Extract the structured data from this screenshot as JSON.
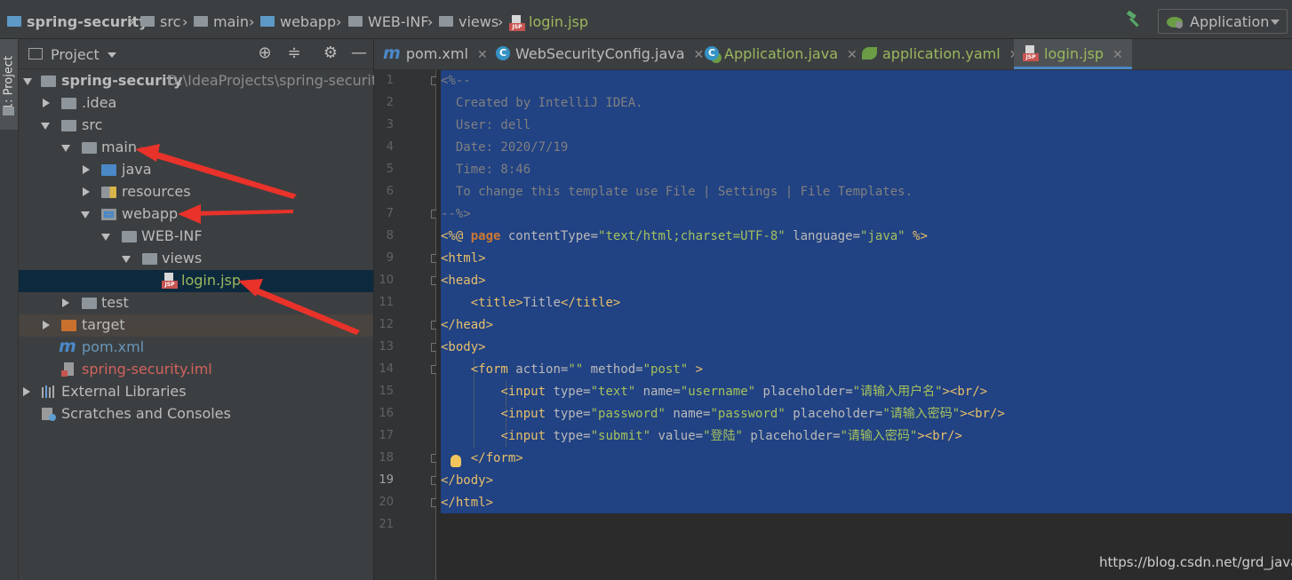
{
  "breadcrumbs": [
    {
      "label": "spring-security",
      "icon": "module-folder-icon",
      "bold": true
    },
    {
      "label": "src",
      "icon": "folder-icon"
    },
    {
      "label": "main",
      "icon": "folder-icon"
    },
    {
      "label": "webapp",
      "icon": "web-folder-icon"
    },
    {
      "label": "WEB-INF",
      "icon": "folder-icon"
    },
    {
      "label": "views",
      "icon": "folder-icon"
    },
    {
      "label": "login.jsp",
      "icon": "jsp-file-icon",
      "active": true
    }
  ],
  "run_config": {
    "label": "Application"
  },
  "tool_strip": {
    "project_tab": "1: Project"
  },
  "project_panel": {
    "title": "Project",
    "tree": [
      {
        "label": "spring-security",
        "path": "D:\\IdeaProjects\\spring-security",
        "icon": "module-folder-icon",
        "expanded": true
      },
      {
        "label": ".idea",
        "icon": "folder-icon",
        "expanded": false
      },
      {
        "label": "src",
        "icon": "folder-icon",
        "expanded": true
      },
      {
        "label": "main",
        "icon": "folder-icon",
        "expanded": true
      },
      {
        "label": "java",
        "icon": "source-folder-icon",
        "expanded": false
      },
      {
        "label": "resources",
        "icon": "resources-folder-icon",
        "expanded": false
      },
      {
        "label": "webapp",
        "icon": "web-folder-icon",
        "expanded": true
      },
      {
        "label": "WEB-INF",
        "icon": "folder-icon",
        "expanded": true
      },
      {
        "label": "views",
        "icon": "folder-icon",
        "expanded": true
      },
      {
        "label": "login.jsp",
        "icon": "jsp-file-icon",
        "selected": true
      },
      {
        "label": "test",
        "icon": "folder-icon",
        "expanded": false
      },
      {
        "label": "target",
        "icon": "excluded-folder-icon",
        "expanded": false
      },
      {
        "label": "pom.xml",
        "icon": "maven-icon"
      },
      {
        "label": "spring-security.iml",
        "icon": "iml-file-icon"
      },
      {
        "label": "External Libraries",
        "icon": "libraries-icon",
        "expanded": false
      },
      {
        "label": "Scratches and Consoles",
        "icon": "scratches-icon"
      }
    ]
  },
  "tabs": [
    {
      "label": "pom.xml",
      "icon": "maven-icon"
    },
    {
      "label": "WebSecurityConfig.java",
      "icon": "class-icon"
    },
    {
      "label": "Application.java",
      "icon": "spring-class-icon"
    },
    {
      "label": "application.yaml",
      "icon": "spring-yaml-icon"
    },
    {
      "label": "login.jsp",
      "icon": "jsp-file-icon",
      "active": true
    }
  ],
  "editor": {
    "line_numbers": [
      "1",
      "2",
      "3",
      "4",
      "5",
      "6",
      "7",
      "8",
      "9",
      "10",
      "11",
      "12",
      "13",
      "14",
      "15",
      "16",
      "17",
      "18",
      "19",
      "20",
      "21"
    ],
    "current_line": "19",
    "lines": [
      [
        {
          "t": "<%--",
          "c": "comment"
        }
      ],
      [
        {
          "t": "  Created by IntelliJ IDEA.",
          "c": "comment"
        }
      ],
      [
        {
          "t": "  User: dell",
          "c": "comment"
        }
      ],
      [
        {
          "t": "  Date: 2020/7/19",
          "c": "comment"
        }
      ],
      [
        {
          "t": "  Time: 8:46",
          "c": "comment"
        }
      ],
      [
        {
          "t": "  To change this template use File | Settings | File Templates.",
          "c": "comment"
        }
      ],
      [
        {
          "t": "--%>",
          "c": "comment"
        }
      ],
      [
        {
          "t": "<%@ ",
          "c": "tag"
        },
        {
          "t": "page",
          "c": "kw"
        },
        {
          "t": " contentType=",
          "c": "attr"
        },
        {
          "t": "\"text/html;charset=UTF-8\"",
          "c": "str"
        },
        {
          "t": " language=",
          "c": "attr"
        },
        {
          "t": "\"java\"",
          "c": "str"
        },
        {
          "t": " %>",
          "c": "tag"
        }
      ],
      [
        {
          "t": "<html>",
          "c": "tag"
        }
      ],
      [
        {
          "t": "<head>",
          "c": "tag"
        }
      ],
      [
        {
          "t": "    ",
          "c": "plain"
        },
        {
          "t": "<title>",
          "c": "tag"
        },
        {
          "t": "Title",
          "c": "plain"
        },
        {
          "t": "</title>",
          "c": "tag"
        }
      ],
      [
        {
          "t": "</head>",
          "c": "tag"
        }
      ],
      [
        {
          "t": "<body>",
          "c": "tag"
        }
      ],
      [
        {
          "t": "    ",
          "c": "plain"
        },
        {
          "t": "<form ",
          "c": "tag"
        },
        {
          "t": "action=",
          "c": "attr"
        },
        {
          "t": "\"\"",
          "c": "str"
        },
        {
          "t": " method=",
          "c": "attr"
        },
        {
          "t": "\"post\"",
          "c": "str"
        },
        {
          "t": " >",
          "c": "tag"
        }
      ],
      [
        {
          "t": "        ",
          "c": "plain"
        },
        {
          "t": "<input ",
          "c": "tag"
        },
        {
          "t": "type=",
          "c": "attr"
        },
        {
          "t": "\"text\"",
          "c": "str"
        },
        {
          "t": " name=",
          "c": "attr"
        },
        {
          "t": "\"username\"",
          "c": "str"
        },
        {
          "t": " placeholder=",
          "c": "attr"
        },
        {
          "t": "\"请输入用户名\"",
          "c": "str"
        },
        {
          "t": "><br/>",
          "c": "tag"
        }
      ],
      [
        {
          "t": "        ",
          "c": "plain"
        },
        {
          "t": "<input ",
          "c": "tag"
        },
        {
          "t": "type=",
          "c": "attr"
        },
        {
          "t": "\"password\"",
          "c": "str"
        },
        {
          "t": " name=",
          "c": "attr"
        },
        {
          "t": "\"password\"",
          "c": "str"
        },
        {
          "t": " placeholder=",
          "c": "attr"
        },
        {
          "t": "\"请输入密码\"",
          "c": "str"
        },
        {
          "t": "><br/>",
          "c": "tag"
        }
      ],
      [
        {
          "t": "        ",
          "c": "plain"
        },
        {
          "t": "<input ",
          "c": "tag"
        },
        {
          "t": "type=",
          "c": "attr"
        },
        {
          "t": "\"submit\"",
          "c": "str"
        },
        {
          "t": " value=",
          "c": "attr"
        },
        {
          "t": "\"登陆\"",
          "c": "str"
        },
        {
          "t": " placeholder=",
          "c": "attr"
        },
        {
          "t": "\"请输入密码\"",
          "c": "str"
        },
        {
          "t": "><br/>",
          "c": "tag"
        }
      ],
      [
        {
          "t": "    ",
          "c": "plain"
        },
        {
          "t": "</form>",
          "c": "tag"
        }
      ],
      [
        {
          "t": "</body>",
          "c": "tag"
        }
      ],
      [
        {
          "t": "</html>",
          "c": "tag"
        }
      ],
      []
    ]
  },
  "watermark": "https://blog.csdn.net/grd_java",
  "colors": {
    "selection": "#214283",
    "annotation_arrow": "#e8322a",
    "tree_selection": "#0d293e"
  }
}
